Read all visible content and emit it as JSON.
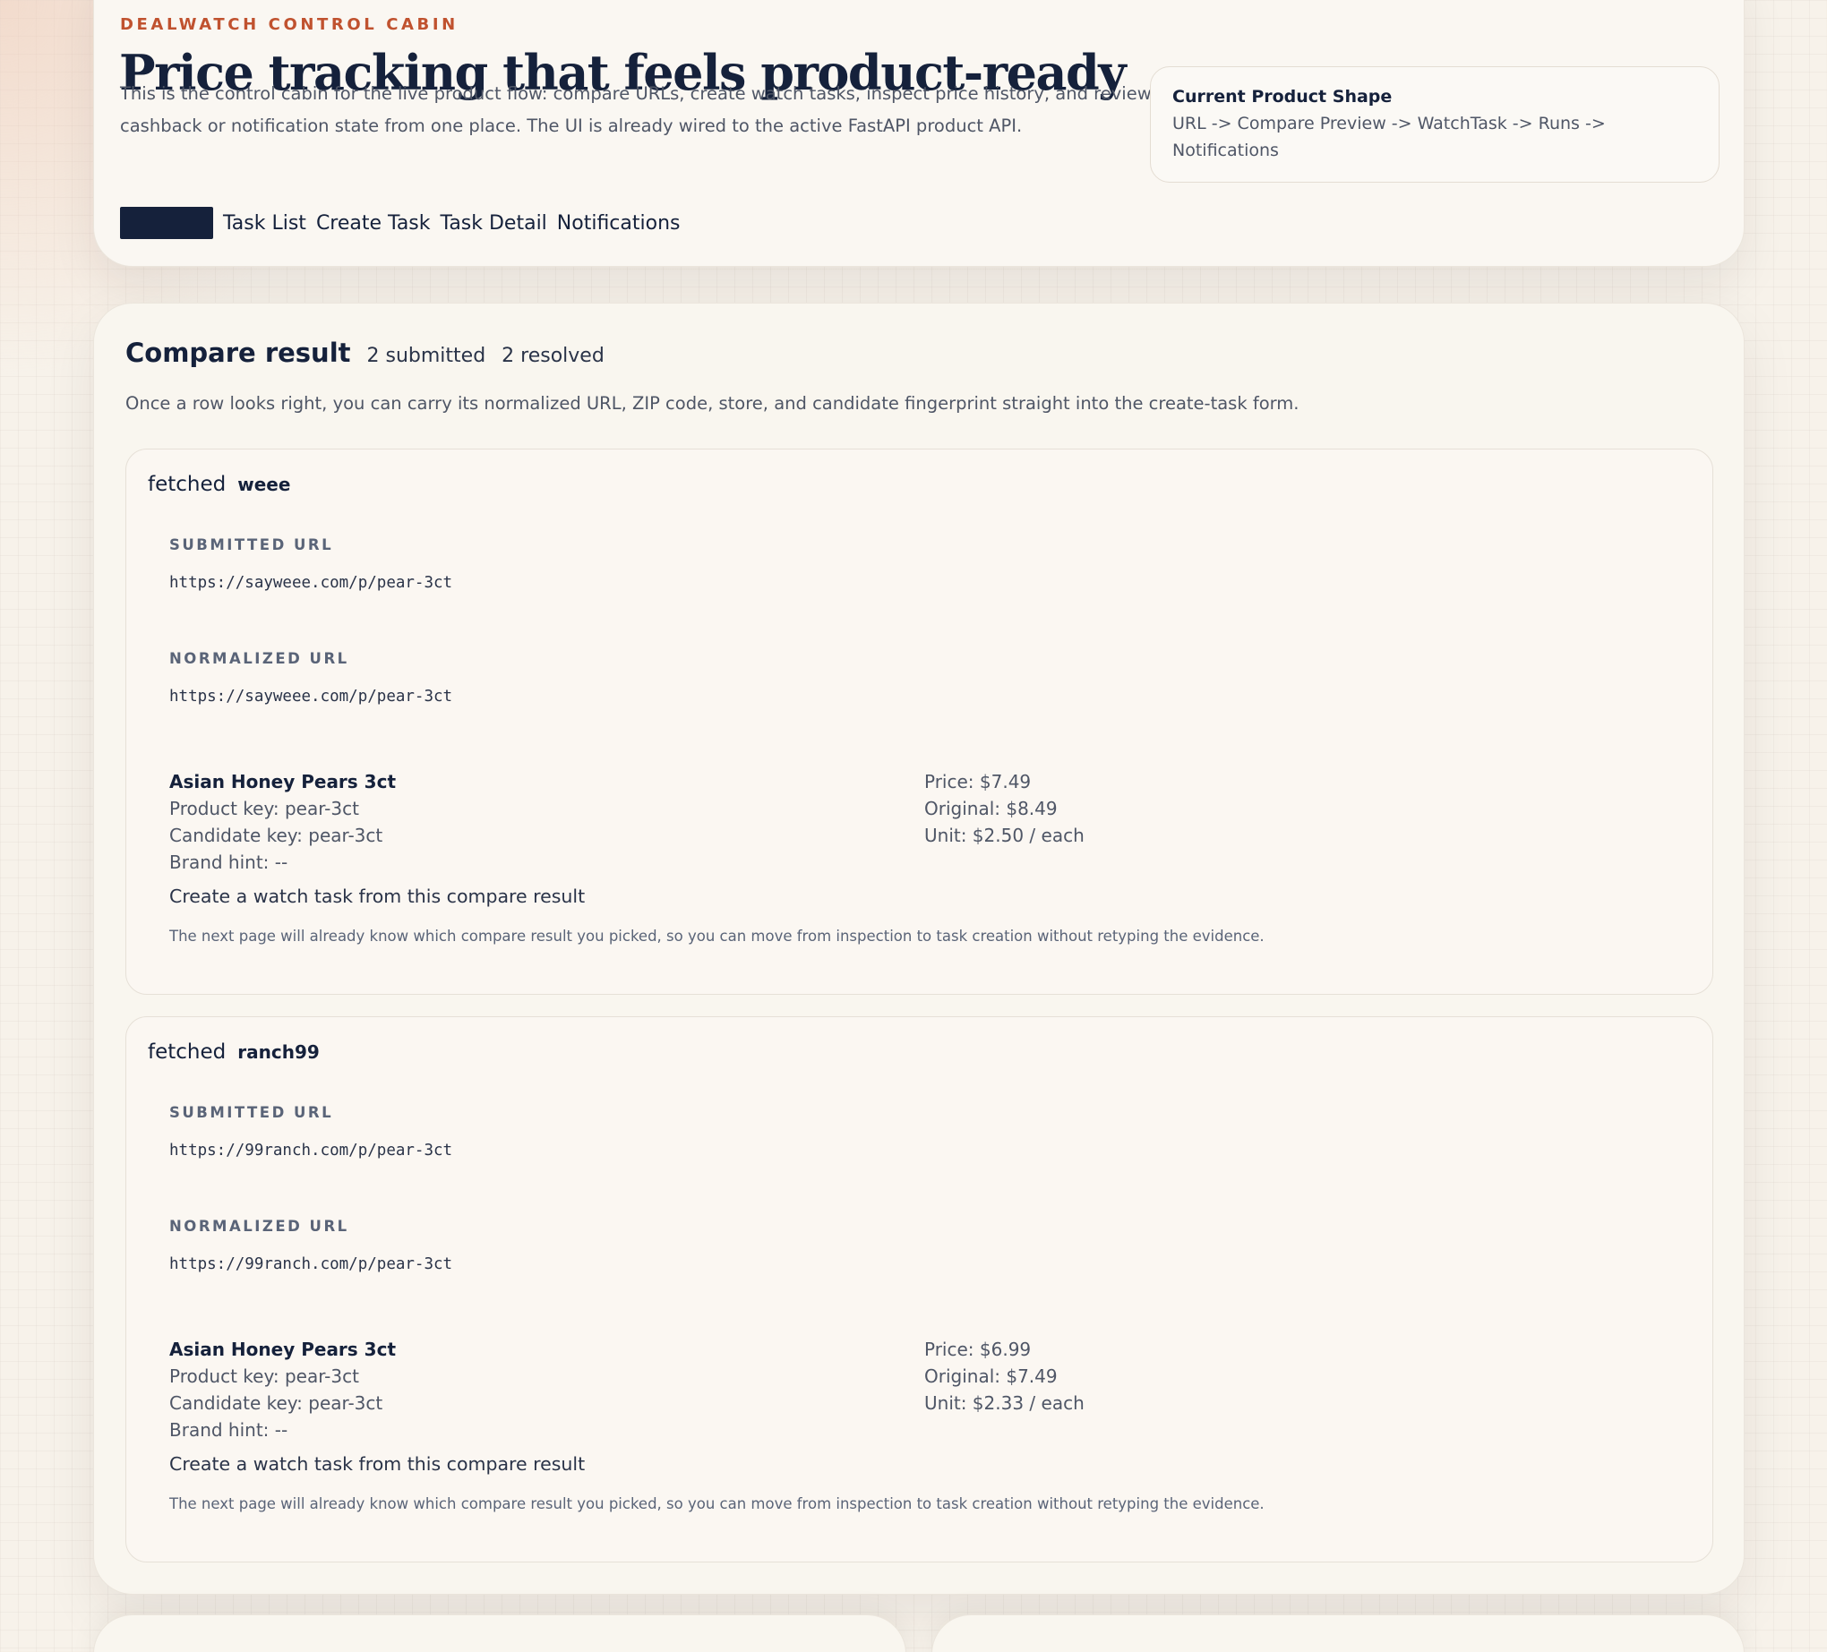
{
  "hero": {
    "eyebrow": "DEALWATCH CONTROL CABIN",
    "title": "Price tracking that feels product-ready",
    "description": "This is the control cabin for the live product flow: compare URLs, create watch tasks, inspect price history, and review cashback or notification state from one place. The UI is already wired to the active FastAPI product API.",
    "nav": {
      "task_list": "Task List",
      "create_task": "Create Task",
      "task_detail": "Task Detail",
      "notifications": "Notifications"
    },
    "shape_card": {
      "title": "Current Product Shape",
      "text": "URL -> Compare Preview -> WatchTask -> Runs -> Notifications"
    }
  },
  "compare": {
    "title": "Compare result",
    "submitted": "2 submitted",
    "resolved": "2 resolved",
    "description": "Once a row looks right, you can carry its normalized URL, ZIP code, store, and candidate fingerprint straight into the create-task form.",
    "submitted_url_label": "SUBMITTED URL",
    "normalized_url_label": "NORMALIZED URL",
    "results": [
      {
        "status": "fetched",
        "store": "weee",
        "submitted_url": "https://sayweee.com/p/pear-3ct",
        "normalized_url": "https://sayweee.com/p/pear-3ct",
        "product_name": "Asian Honey Pears 3ct",
        "product_key": "Product key: pear-3ct",
        "candidate_key": "Candidate key: pear-3ct",
        "brand_hint": "Brand hint: --",
        "price": "Price: $7.49",
        "original": "Original: $8.49",
        "unit": "Unit: $2.50 / each",
        "action": "Create a watch task from this compare result",
        "hint": "The next page will already know which compare result you picked, so you can move from inspection to task creation without retyping the evidence."
      },
      {
        "status": "fetched",
        "store": "ranch99",
        "submitted_url": "https://99ranch.com/p/pear-3ct",
        "normalized_url": "https://99ranch.com/p/pear-3ct",
        "product_name": "Asian Honey Pears 3ct",
        "product_key": "Product key: pear-3ct",
        "candidate_key": "Candidate key: pear-3ct",
        "brand_hint": "Brand hint: --",
        "price": "Price: $6.99",
        "original": "Original: $7.49",
        "unit": "Unit: $2.33 / each",
        "action": "Create a watch task from this compare result",
        "hint": "The next page will already know which compare result you picked, so you can move from inspection to task creation without retyping the evidence."
      }
    ]
  }
}
